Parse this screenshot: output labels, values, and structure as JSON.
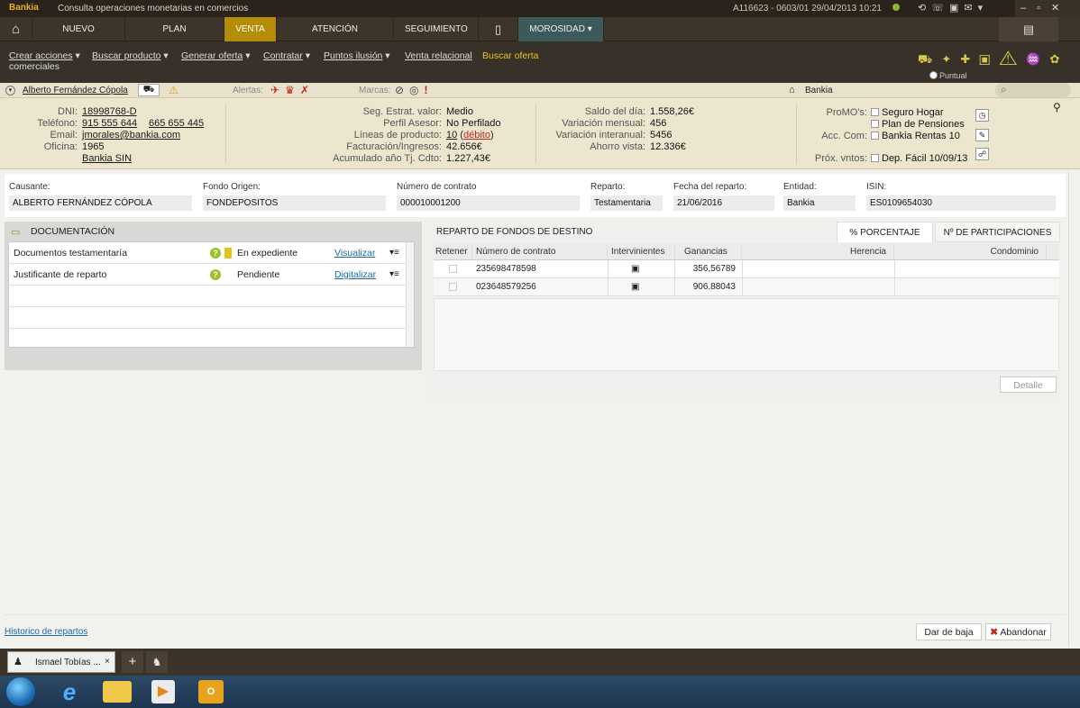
{
  "titlebar": {
    "brand": "Bankia",
    "title": "Consulta operaciones monetarias en comercios",
    "meta": "A116623 - 0603/01    29/04/2013    10:21"
  },
  "nav": [
    "NUEVO CLIENTE",
    "PLAN COMERCIAL",
    "VENTA",
    "ATENCIÓN COMERCIAL",
    "SEGUIMIENTO",
    "MOROSIDAD"
  ],
  "subnav": {
    "crear": "Crear acciones",
    "crear2": "comerciales",
    "buscar_producto": "Buscar producto",
    "generar": "Generar oferta",
    "contratar": "Contratar",
    "puntos": "Puntos ilusión",
    "venta": "Venta relacional",
    "buscar_oferta": "Buscar oferta",
    "puntual": "Puntual"
  },
  "client": {
    "name": "Alberto Fernández Cópola",
    "alertas": "Alertas:",
    "marcas": "Marcas:",
    "bank": "Bankia"
  },
  "info": {
    "dni_l": "DNI:",
    "dni": "18998768-D",
    "tel_l": "Teléfono:",
    "tel1": "915 555 644",
    "tel2": "665 655 445",
    "email_l": "Email:",
    "email": "jmorales@bankia.com",
    "ofi_l": "Oficina:",
    "ofi": "1965",
    "sin": "Bankia SIN",
    "seg_l": "Seg. Estrat. valor:",
    "seg": "Medio",
    "perf_l": "Perfil Asesor:",
    "perf": "No Perfilado",
    "lin_l": "Líneas de producto:",
    "lin1": "10",
    "lin2": "débito",
    "fac_l": "Facturación/Ingresos:",
    "fac": "42.656€",
    "acu_l": "Acumulado año Tj. Cdto:",
    "acu": "1.227,43€",
    "sal_l": "Saldo del día:",
    "sal": "1.558,26€",
    "vm_l": "Variación mensual:",
    "vm": "456",
    "vi_l": "Variación interanual:",
    "vi": "5456",
    "ah_l": "Ahorro vista:",
    "ah": "12.336€",
    "promo_l": "ProMO's:",
    "promo1": "Seguro Hogar",
    "promo2": "Plan de Pensiones",
    "acc_l": "Acc. Com:",
    "acc": "Bankia Rentas 10",
    "prox_l": "Próx. vntos:",
    "prox": "Dep. Fácil 10/09/13"
  },
  "fields": {
    "causante_l": "Causante:",
    "causante": "ALBERTO FERNÁNDEZ CÓPOLA",
    "fondo_l": "Fondo Origen:",
    "fondo": "FONDEPOSITOS",
    "num_l": "Número de contrato",
    "num": "000010001200",
    "rep_l": "Reparto:",
    "rep": "Testamentaria",
    "fecha_l": "Fecha del reparto:",
    "fecha": "21/06/2016",
    "ent_l": "Entidad:",
    "ent": "Bankia",
    "isin_l": "ISIN:",
    "isin": "ES0109654030"
  },
  "doc": {
    "title": "DOCUMENTACIÓN",
    "rows": [
      {
        "name": "Documentos testamentaría",
        "status": "En expediente",
        "action": "Visualizar"
      },
      {
        "name": "Justificante de reparto",
        "status": "Pendiente",
        "action": "Digitalizar"
      }
    ]
  },
  "reparto": {
    "title": "REPARTO DE FONDOS DE DESTINO",
    "tab1": "% PORCENTAJE",
    "tab2": "Nº DE PARTICIPACIONES",
    "headers": [
      "Retener",
      "Número de contrato",
      "Intervinientes",
      "Ganancias",
      "Herencia",
      "Condominio"
    ],
    "rows": [
      {
        "contract": "235698478598",
        "gain": "356,56789"
      },
      {
        "contract": "023648579256",
        "gain": "906.88043"
      }
    ],
    "detalle": "Detalle"
  },
  "footer": {
    "historico": "Historico de repartos",
    "baja": "Dar de baja",
    "abandonar": "Abandonar"
  },
  "tab": {
    "user": "Ismael Tobías ..."
  }
}
